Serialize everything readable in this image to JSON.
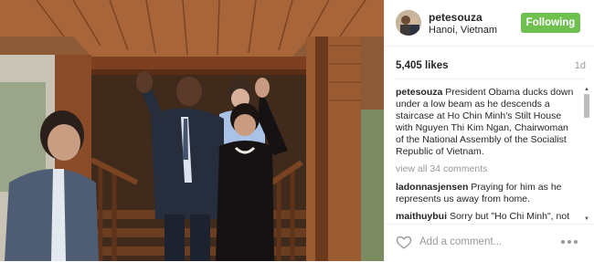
{
  "post": {
    "username": "petesouza",
    "location": "Hanoi, Vietnam",
    "follow_label": "Following",
    "likes": "5,405 likes",
    "time_ago": "1d"
  },
  "caption": {
    "username": "petesouza",
    "text": "President Obama ducks down under a low beam as he descends a staircase at Ho Chin Minh's Stilt House with Nguyen Thi Kim Ngan, Chairwoman of the National Assembly of the Socialist Republic of Vietnam."
  },
  "view_all_label": "view all 34 comments",
  "comments": [
    {
      "username": "ladonnasjensen",
      "text": "Praying for him as he represents us away from home."
    },
    {
      "username": "maithuybui",
      "text": "Sorry but \"Ho Chi Minh\", not \"Ho Chin Minh\" 😒"
    }
  ],
  "add_comment_placeholder": "Add a comment...",
  "icons": {
    "like": "heart-outline-icon",
    "more": "more-options-icon",
    "scroll_up": "arrow-up-icon",
    "scroll_down": "arrow-down-icon"
  },
  "colors": {
    "follow_button": "#70c050",
    "muted_text": "#999999",
    "divider": "#efefef"
  }
}
